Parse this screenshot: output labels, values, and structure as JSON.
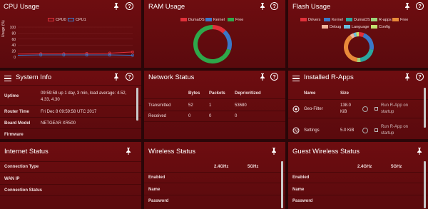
{
  "colors": {
    "cpu0": "#e0303a",
    "cpu1": "#3a78c8",
    "ram_dumaos": "#e0303a",
    "ram_kernel": "#3a78c8",
    "ram_free": "#2ea84a",
    "flash_drivers": "#e0303a",
    "flash_kernel": "#3a78c8",
    "flash_dumaos": "#2aa7a0",
    "flash_rapps": "#9ad37a",
    "flash_free": "#e88a3a",
    "flash_debug": "#f0b49a",
    "flash_language": "#6ac0e0",
    "flash_config": "#c4e070"
  },
  "cpu": {
    "title": "CPU Usage",
    "legend": [
      "CPU0",
      "CPU1"
    ],
    "y_label": "Usage (%)",
    "y_ticks": [
      "100",
      "80",
      "60",
      "40",
      "20",
      "0"
    ]
  },
  "chart_data": {
    "type": "line",
    "ylabel": "Usage (%)",
    "ylim": [
      0,
      100
    ],
    "x": [
      0,
      1,
      2,
      3,
      4,
      5
    ],
    "series": [
      {
        "name": "CPU0",
        "values": [
          10,
          11,
          11,
          12,
          13,
          17
        ]
      },
      {
        "name": "CPU1",
        "values": [
          6,
          7,
          7,
          7,
          7,
          6
        ]
      }
    ]
  },
  "ram": {
    "title": "RAM Usage",
    "legend": [
      "DumaOS",
      "Kernel",
      "Free"
    ],
    "slices": [
      {
        "name": "DumaOS",
        "value": 12
      },
      {
        "name": "Kernel",
        "value": 18
      },
      {
        "name": "Free",
        "value": 70
      }
    ]
  },
  "flash": {
    "title": "Flash Usage",
    "legend_row1": [
      "Drivers",
      "Kernel",
      "DumaOS",
      "R-apps",
      "Free"
    ],
    "legend_row2": [
      "Debug",
      "Language",
      "Config"
    ],
    "slices": [
      {
        "name": "Drivers",
        "value": 6
      },
      {
        "name": "Kernel",
        "value": 22
      },
      {
        "name": "DumaOS",
        "value": 20
      },
      {
        "name": "R-apps",
        "value": 4
      },
      {
        "name": "Free",
        "value": 38
      },
      {
        "name": "Debug",
        "value": 4
      },
      {
        "name": "Language",
        "value": 3
      },
      {
        "name": "Config",
        "value": 3
      }
    ]
  },
  "sysinfo": {
    "title": "System Info",
    "uptime_label": "Uptime",
    "uptime_line1": "09:59:58 up 1 day, 3 min, load average: 4.52,",
    "uptime_line2": "4.33, 4.30",
    "router_time_label": "Router Time",
    "router_time": "Fri Dec 8 09:59:58 UTC 2017",
    "board_model_label": "Board Model",
    "board_model": "NETGEAR XR500",
    "firmware_label": "Firmware"
  },
  "network": {
    "title": "Network Status",
    "headers": [
      "Bytes",
      "Packets",
      "Deprioritized"
    ],
    "rows": [
      {
        "label": "Transmitted",
        "bytes": "52",
        "packets": "1",
        "deprioritized": "53680"
      },
      {
        "label": "Received",
        "bytes": "0",
        "packets": "0",
        "deprioritized": "0"
      }
    ]
  },
  "rapps": {
    "title": "Installed R-Apps",
    "headers": [
      "Name",
      "Size"
    ],
    "items": [
      {
        "name": "Geo-Filter",
        "size_line1": "138.0",
        "size_line2": "KiB",
        "action_line1": "Run R-App on",
        "action_line2": "startup"
      },
      {
        "name": "Settings",
        "size_line1": "5.0 KiB",
        "size_line2": "",
        "action_line1": "Run R-App on",
        "action_line2": "startup"
      }
    ]
  },
  "internet": {
    "title": "Internet Status",
    "rows": [
      "Connection Type",
      "WAN IP",
      "Connection Status"
    ]
  },
  "wireless": {
    "title": "Wireless Status",
    "cols": [
      "2.4GHz",
      "5GHz"
    ],
    "rows": [
      "Enabled",
      "Name",
      "Password"
    ]
  },
  "guest": {
    "title": "Guest Wireless Status",
    "cols": [
      "2.4GHz",
      "5GHz"
    ],
    "rows": [
      "Enabled",
      "Name",
      "Password"
    ]
  }
}
